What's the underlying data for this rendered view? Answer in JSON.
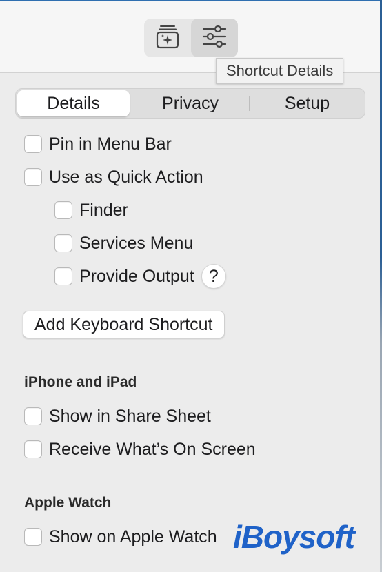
{
  "toolbar": {
    "left_icon": "add-to-library-icon",
    "right_icon": "sliders-icon",
    "tooltip": "Shortcut Details"
  },
  "tabs": [
    {
      "label": "Details",
      "selected": true
    },
    {
      "label": "Privacy",
      "selected": false
    },
    {
      "label": "Setup",
      "selected": false
    }
  ],
  "options": {
    "pin_menu_bar": {
      "label": "Pin in Menu Bar",
      "checked": false
    },
    "quick_action": {
      "label": "Use as Quick Action",
      "checked": false
    },
    "finder": {
      "label": "Finder",
      "checked": false
    },
    "services_menu": {
      "label": "Services Menu",
      "checked": false
    },
    "provide_output": {
      "label": "Provide Output",
      "checked": false,
      "help": "?"
    }
  },
  "keyboard_shortcut_button": "Add Keyboard Shortcut",
  "iphone_section": {
    "title": "iPhone and iPad",
    "share_sheet": {
      "label": "Show in Share Sheet",
      "checked": false
    },
    "whats_on_screen": {
      "label": "Receive What’s On Screen",
      "checked": false
    }
  },
  "watch_section": {
    "title": "Apple Watch",
    "show_on_watch": {
      "label": "Show on Apple Watch",
      "checked": false
    }
  },
  "watermark": "iBoysoft",
  "colors": {
    "accent": "#1f62c8",
    "background": "#ececec"
  }
}
